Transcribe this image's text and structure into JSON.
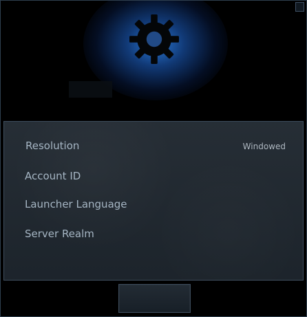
{
  "header": {
    "icon_name": "gear-icon",
    "accent_color": "#2c7ee0"
  },
  "window": {
    "close_icon_name": "close-icon"
  },
  "settings": {
    "rows": [
      {
        "label": "Resolution",
        "value": "Windowed"
      },
      {
        "label": "Account ID"
      },
      {
        "label": "Launcher Language"
      },
      {
        "label": "Server Realm"
      }
    ]
  },
  "footer": {
    "button_label": ""
  }
}
